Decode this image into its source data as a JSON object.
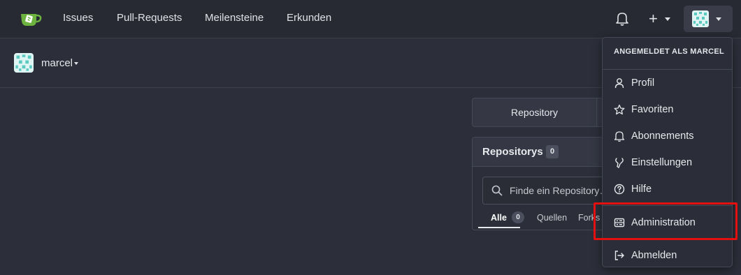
{
  "colors": {
    "navbar_bg": "#282a33",
    "page_bg": "#2c2f3a",
    "accent_logo": "#6cb33f",
    "highlight": "#e31010"
  },
  "navbar": {
    "logo_icon": "gitea-teacup-icon",
    "items": [
      "Issues",
      "Pull-Requests",
      "Meilensteine",
      "Erkunden"
    ],
    "icons": [
      "bell-icon",
      "plus-icon",
      "avatar"
    ]
  },
  "context": {
    "user": "marcel"
  },
  "repo_panel": {
    "tab_label": "Repository",
    "title": "Repositorys",
    "count": "0",
    "search_placeholder": "Finde ein Repository…",
    "filters": [
      {
        "label": "Alle",
        "badge": "0"
      },
      {
        "label": "Quellen"
      },
      {
        "label": "Forks"
      }
    ]
  },
  "user_menu": {
    "header": "ANGEMELDET ALS MARCEL",
    "items": [
      {
        "label": "Profil",
        "icon": "person-icon"
      },
      {
        "label": "Favoriten",
        "icon": "star-icon"
      },
      {
        "label": "Abonnements",
        "icon": "bell-icon"
      },
      {
        "label": "Einstellungen",
        "icon": "tools-icon"
      },
      {
        "label": "Hilfe",
        "icon": "question-icon"
      },
      {
        "label": "Administration",
        "icon": "server-icon"
      },
      {
        "label": "Abmelden",
        "icon": "sign-out-icon"
      }
    ]
  }
}
